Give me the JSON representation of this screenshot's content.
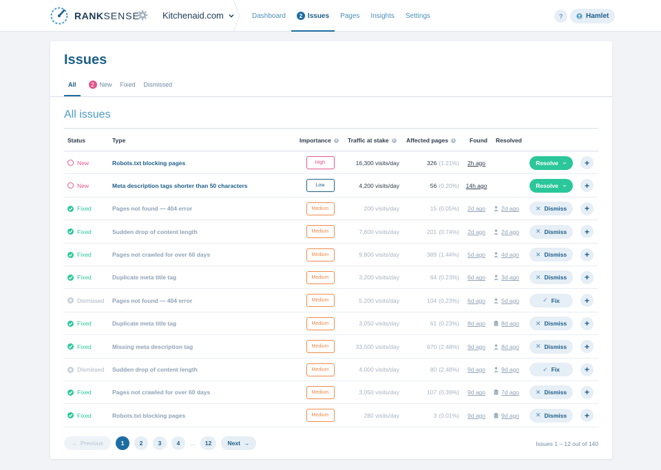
{
  "brand": {
    "name_bold": "RANK",
    "name_light": "SENSE"
  },
  "site": {
    "name": "Kitchenaid.com"
  },
  "nav": {
    "items": [
      {
        "label": "Dashboard",
        "badge": ""
      },
      {
        "label": "Issues",
        "badge": "2"
      },
      {
        "label": "Pages",
        "badge": ""
      },
      {
        "label": "Insights",
        "badge": ""
      },
      {
        "label": "Settings",
        "badge": ""
      }
    ],
    "active": "Issues"
  },
  "help": {
    "label": "?"
  },
  "user": {
    "name": "Hamlet"
  },
  "page": {
    "title": "Issues",
    "section_title": "All issues"
  },
  "subtabs": {
    "all": "All",
    "new": "New",
    "new_badge": "2",
    "fixed": "Fixed",
    "dismissed": "Dismissed"
  },
  "table": {
    "headers": {
      "status": "Status",
      "type": "Type",
      "importance": "Importance",
      "traffic": "Traffic at stake",
      "affected": "Affected pages",
      "found": "Found",
      "resolved": "Resolved"
    },
    "rows": [
      {
        "status": "New",
        "type": "Robots.txt blocking pages",
        "importance": "High",
        "traffic": "16,300 visits/day",
        "affected": "326",
        "pct": "(1.21%)",
        "found": "2h ago",
        "resolved": "",
        "action": "Resolve"
      },
      {
        "status": "New",
        "type": "Meta description tags shorter than 50 characters",
        "importance": "Low",
        "traffic": "4,200 visits/day",
        "affected": "56",
        "pct": "(0.20%)",
        "found": "14h ago",
        "resolved": "",
        "action": "Resolve"
      },
      {
        "status": "Fixed",
        "type": "Pages not found — 404 error",
        "importance": "Medium",
        "traffic": "200 visits/day",
        "affected": "15",
        "pct": "(0.05%)",
        "found": "2d ago",
        "resolved": "2d ago",
        "action": "Dismiss"
      },
      {
        "status": "Fixed",
        "type": "Sudden drop of content length",
        "importance": "Medium",
        "traffic": "7,600 visits/day",
        "affected": "201",
        "pct": "(0.74%)",
        "found": "2d ago",
        "resolved": "2d ago",
        "action": "Dismiss"
      },
      {
        "status": "Fixed",
        "type": "Pages not crawled for over 60 days",
        "importance": "Medium",
        "traffic": "9,800 visits/day",
        "affected": "389",
        "pct": "(1.44%)",
        "found": "5d ago",
        "resolved": "4d ago",
        "action": "Dismiss"
      },
      {
        "status": "Fixed",
        "type": "Duplicate meta title tag",
        "importance": "Medium",
        "traffic": "3,200 visits/day",
        "affected": "64",
        "pct": "(0.23%)",
        "found": "6d ago",
        "resolved": "3d ago",
        "action": "Dismiss"
      },
      {
        "status": "Dismissed",
        "type": "Pages not found — 404 error",
        "importance": "Medium",
        "traffic": "5,200 visits/day",
        "affected": "104",
        "pct": "(0.23%)",
        "found": "6d ago",
        "resolved": "5d ago",
        "action": "Fix"
      },
      {
        "status": "Fixed",
        "type": "Duplicate meta title tag",
        "importance": "Medium",
        "traffic": "3,050 visits/day",
        "affected": "61",
        "pct": "(0.23%)",
        "found": "8d ago",
        "resolved": "8d ago",
        "action": "Dismiss"
      },
      {
        "status": "Fixed",
        "type": "Missing meta description tag",
        "importance": "Medium",
        "traffic": "33,500 visits/day",
        "affected": "670",
        "pct": "(2.48%)",
        "found": "9d ago",
        "resolved": "8d ago",
        "action": "Dismiss"
      },
      {
        "status": "Dismissed",
        "type": "Sudden drop of content length",
        "importance": "Medium",
        "traffic": "4,000 visits/day",
        "affected": "80",
        "pct": "(2.48%)",
        "found": "9d ago",
        "resolved": "9d ago",
        "action": "Fix"
      },
      {
        "status": "Fixed",
        "type": "Pages not crawled for over 60 days",
        "importance": "Medium",
        "traffic": "3,050 visits/day",
        "affected": "107",
        "pct": "(0.39%)",
        "found": "9d ago",
        "resolved": "7d ago",
        "action": "Dismiss"
      },
      {
        "status": "Fixed",
        "type": "Robots.txt blocking pages",
        "importance": "Medium",
        "traffic": "280 visits/day",
        "affected": "3",
        "pct": "(0.01%)",
        "found": "9d ago",
        "resolved": "9d ago",
        "action": "Dismiss"
      }
    ],
    "resolver_icons": [
      "",
      "",
      "user-icon",
      "user-icon",
      "user-icon",
      "user-icon",
      "user-icon",
      "clipboard-icon",
      "user-icon",
      "user-icon",
      "clipboard-icon",
      "clipboard-icon"
    ],
    "plus_label": "+"
  },
  "pagination": {
    "previous": "Previous",
    "next": "Next",
    "pages": [
      "1",
      "2",
      "3",
      "4"
    ],
    "ellipsis": "...",
    "last": "12",
    "current": "1",
    "summary": "Issues 1 – 12 out of 140"
  },
  "colors": {
    "primary": "#1d5f8a",
    "accent_blue": "#4b9ac9",
    "new": "#e2568b",
    "fixed": "#2bc79a",
    "dismissed": "#a6b4c2",
    "medium": "#f08a4b"
  }
}
